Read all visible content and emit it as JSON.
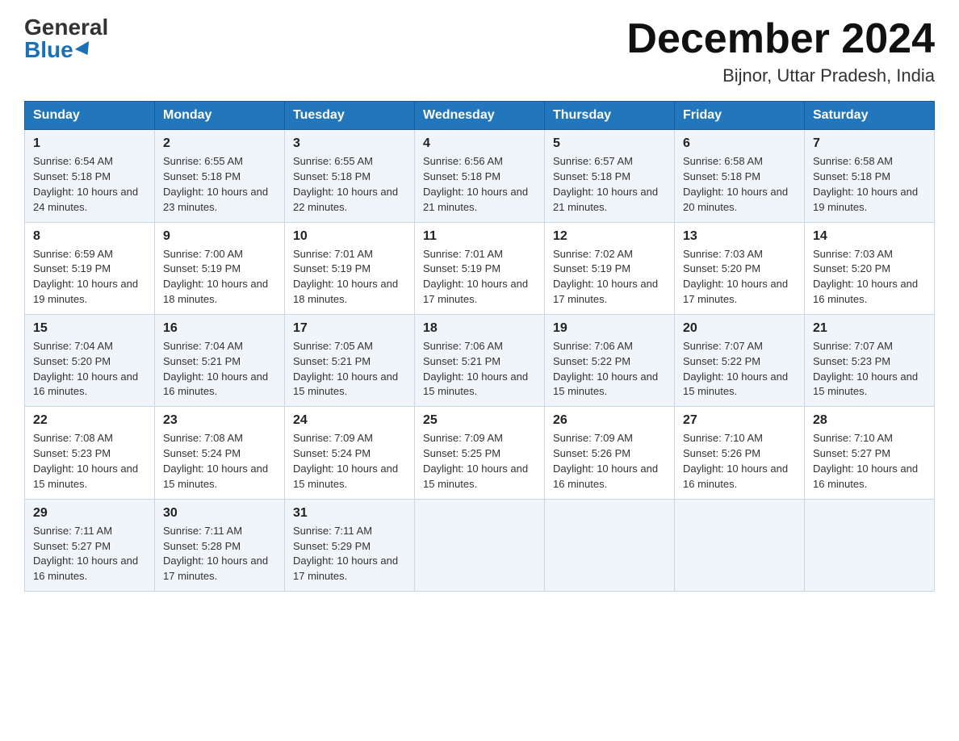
{
  "header": {
    "logo_general": "General",
    "logo_blue": "Blue",
    "month_title": "December 2024",
    "location": "Bijnor, Uttar Pradesh, India"
  },
  "columns": [
    "Sunday",
    "Monday",
    "Tuesday",
    "Wednesday",
    "Thursday",
    "Friday",
    "Saturday"
  ],
  "weeks": [
    [
      {
        "day": "1",
        "sunrise": "6:54 AM",
        "sunset": "5:18 PM",
        "daylight": "10 hours and 24 minutes."
      },
      {
        "day": "2",
        "sunrise": "6:55 AM",
        "sunset": "5:18 PM",
        "daylight": "10 hours and 23 minutes."
      },
      {
        "day": "3",
        "sunrise": "6:55 AM",
        "sunset": "5:18 PM",
        "daylight": "10 hours and 22 minutes."
      },
      {
        "day": "4",
        "sunrise": "6:56 AM",
        "sunset": "5:18 PM",
        "daylight": "10 hours and 21 minutes."
      },
      {
        "day": "5",
        "sunrise": "6:57 AM",
        "sunset": "5:18 PM",
        "daylight": "10 hours and 21 minutes."
      },
      {
        "day": "6",
        "sunrise": "6:58 AM",
        "sunset": "5:18 PM",
        "daylight": "10 hours and 20 minutes."
      },
      {
        "day": "7",
        "sunrise": "6:58 AM",
        "sunset": "5:18 PM",
        "daylight": "10 hours and 19 minutes."
      }
    ],
    [
      {
        "day": "8",
        "sunrise": "6:59 AM",
        "sunset": "5:19 PM",
        "daylight": "10 hours and 19 minutes."
      },
      {
        "day": "9",
        "sunrise": "7:00 AM",
        "sunset": "5:19 PM",
        "daylight": "10 hours and 18 minutes."
      },
      {
        "day": "10",
        "sunrise": "7:01 AM",
        "sunset": "5:19 PM",
        "daylight": "10 hours and 18 minutes."
      },
      {
        "day": "11",
        "sunrise": "7:01 AM",
        "sunset": "5:19 PM",
        "daylight": "10 hours and 17 minutes."
      },
      {
        "day": "12",
        "sunrise": "7:02 AM",
        "sunset": "5:19 PM",
        "daylight": "10 hours and 17 minutes."
      },
      {
        "day": "13",
        "sunrise": "7:03 AM",
        "sunset": "5:20 PM",
        "daylight": "10 hours and 17 minutes."
      },
      {
        "day": "14",
        "sunrise": "7:03 AM",
        "sunset": "5:20 PM",
        "daylight": "10 hours and 16 minutes."
      }
    ],
    [
      {
        "day": "15",
        "sunrise": "7:04 AM",
        "sunset": "5:20 PM",
        "daylight": "10 hours and 16 minutes."
      },
      {
        "day": "16",
        "sunrise": "7:04 AM",
        "sunset": "5:21 PM",
        "daylight": "10 hours and 16 minutes."
      },
      {
        "day": "17",
        "sunrise": "7:05 AM",
        "sunset": "5:21 PM",
        "daylight": "10 hours and 15 minutes."
      },
      {
        "day": "18",
        "sunrise": "7:06 AM",
        "sunset": "5:21 PM",
        "daylight": "10 hours and 15 minutes."
      },
      {
        "day": "19",
        "sunrise": "7:06 AM",
        "sunset": "5:22 PM",
        "daylight": "10 hours and 15 minutes."
      },
      {
        "day": "20",
        "sunrise": "7:07 AM",
        "sunset": "5:22 PM",
        "daylight": "10 hours and 15 minutes."
      },
      {
        "day": "21",
        "sunrise": "7:07 AM",
        "sunset": "5:23 PM",
        "daylight": "10 hours and 15 minutes."
      }
    ],
    [
      {
        "day": "22",
        "sunrise": "7:08 AM",
        "sunset": "5:23 PM",
        "daylight": "10 hours and 15 minutes."
      },
      {
        "day": "23",
        "sunrise": "7:08 AM",
        "sunset": "5:24 PM",
        "daylight": "10 hours and 15 minutes."
      },
      {
        "day": "24",
        "sunrise": "7:09 AM",
        "sunset": "5:24 PM",
        "daylight": "10 hours and 15 minutes."
      },
      {
        "day": "25",
        "sunrise": "7:09 AM",
        "sunset": "5:25 PM",
        "daylight": "10 hours and 15 minutes."
      },
      {
        "day": "26",
        "sunrise": "7:09 AM",
        "sunset": "5:26 PM",
        "daylight": "10 hours and 16 minutes."
      },
      {
        "day": "27",
        "sunrise": "7:10 AM",
        "sunset": "5:26 PM",
        "daylight": "10 hours and 16 minutes."
      },
      {
        "day": "28",
        "sunrise": "7:10 AM",
        "sunset": "5:27 PM",
        "daylight": "10 hours and 16 minutes."
      }
    ],
    [
      {
        "day": "29",
        "sunrise": "7:11 AM",
        "sunset": "5:27 PM",
        "daylight": "10 hours and 16 minutes."
      },
      {
        "day": "30",
        "sunrise": "7:11 AM",
        "sunset": "5:28 PM",
        "daylight": "10 hours and 17 minutes."
      },
      {
        "day": "31",
        "sunrise": "7:11 AM",
        "sunset": "5:29 PM",
        "daylight": "10 hours and 17 minutes."
      },
      null,
      null,
      null,
      null
    ]
  ]
}
